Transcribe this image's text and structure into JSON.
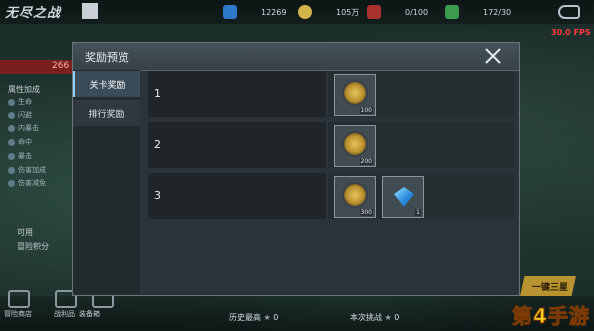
{
  "topbar": {
    "title": "无尽之战",
    "gems": "12269",
    "coins": "105万",
    "stamina": "0/100",
    "flags": "172/30",
    "fps": "30.0 FPS"
  },
  "left_panel": {
    "red_value": "266",
    "stats_heading": "属性加成",
    "stats": [
      "生命",
      "闪避",
      "内暴击",
      "命中",
      "暴击",
      "伤害加成",
      "伤害减免"
    ],
    "bottom_labels": [
      "可用",
      "冒险积分"
    ]
  },
  "bottombar": {
    "items": [
      "冒险商店",
      "战利品",
      "装备箱"
    ],
    "history_label": "历史最高",
    "history_value": "0",
    "next_label": "本次挑战",
    "next_value": "0",
    "start_label": "一键三星",
    "watermark": "第4手游"
  },
  "dialog": {
    "title": "奖励预览",
    "tabs": [
      {
        "label": "关卡奖励",
        "active": true
      },
      {
        "label": "排行奖励",
        "active": false
      }
    ],
    "rows": [
      {
        "num": "1",
        "items": [
          {
            "icon": "medal-icon",
            "qty": "100"
          }
        ]
      },
      {
        "num": "2",
        "items": [
          {
            "icon": "medal-icon",
            "qty": "200"
          }
        ]
      },
      {
        "num": "3",
        "items": [
          {
            "icon": "medal-icon",
            "qty": "300"
          },
          {
            "icon": "diamond-icon",
            "qty": "1"
          }
        ]
      }
    ]
  }
}
